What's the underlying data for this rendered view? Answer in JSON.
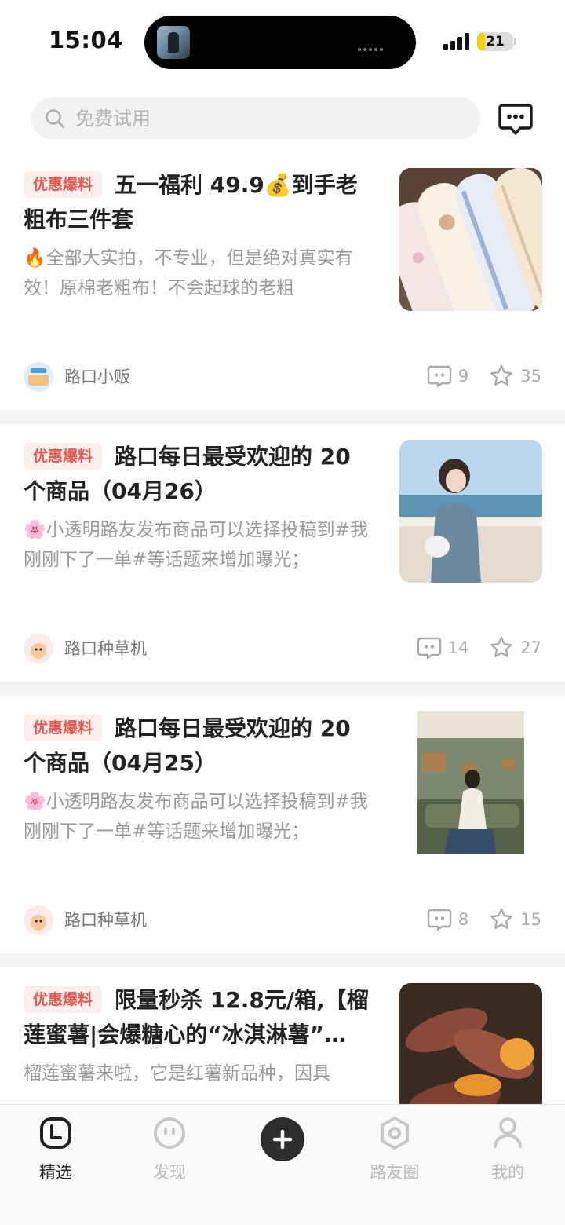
{
  "status_bar": {
    "time": "15:04",
    "battery": "21",
    "battery_level": 0.21
  },
  "search": {
    "placeholder": "免费试用",
    "search_icon": "search-icon",
    "message_icon": "chat-bubble-icon"
  },
  "feed": [
    {
      "tag": "优惠爆料",
      "title": "五一福利 49.9💰到手老粗布三件套",
      "description": "🔥全部大实拍，不专业，但是绝对真实有效！原棉老粗布！不会起球的老粗",
      "author": "路口小贩",
      "comments": "9",
      "likes": "35",
      "image": "rolled-cotton-sheets"
    },
    {
      "tag": "优惠爆料",
      "title": "路口每日最受欢迎的 20 个商品（04月26）",
      "description": "🌸小透明路友发布商品可以选择投稿到#我刚刚下了一单#等话题来增加曝光；",
      "author": "路口种草机",
      "comments": "14",
      "likes": "27",
      "image": "seaside-outfit-photo"
    },
    {
      "tag": "优惠爆料",
      "title": "路口每日最受欢迎的 20 个商品（04月25）",
      "description": "🌸小透明路友发布商品可以选择投稿到#我刚刚下了一单#等话题来增加曝光；",
      "author": "路口种草机",
      "comments": "8",
      "likes": "15",
      "image": "gallery-outfit-photo"
    },
    {
      "tag": "优惠爆料",
      "title": "限量秒杀 12.8元/箱,【榴莲蜜薯|会爆糖心的“冰淇淋薯”…",
      "description": "榴莲蜜薯来啦，它是红薯新品种，因具",
      "author": "",
      "comments": "",
      "likes": "",
      "image": "roasted-sweet-potatoes"
    }
  ],
  "tabbar": {
    "items": [
      {
        "label": "精选",
        "icon": "clock-square-icon",
        "active": true
      },
      {
        "label": "发现",
        "icon": "smiley-face-icon",
        "active": false
      },
      {
        "label": "",
        "icon": "plus-icon",
        "active": false
      },
      {
        "label": "路友圈",
        "icon": "hexagon-icon",
        "active": false
      },
      {
        "label": "我的",
        "icon": "person-icon",
        "active": false
      }
    ]
  }
}
